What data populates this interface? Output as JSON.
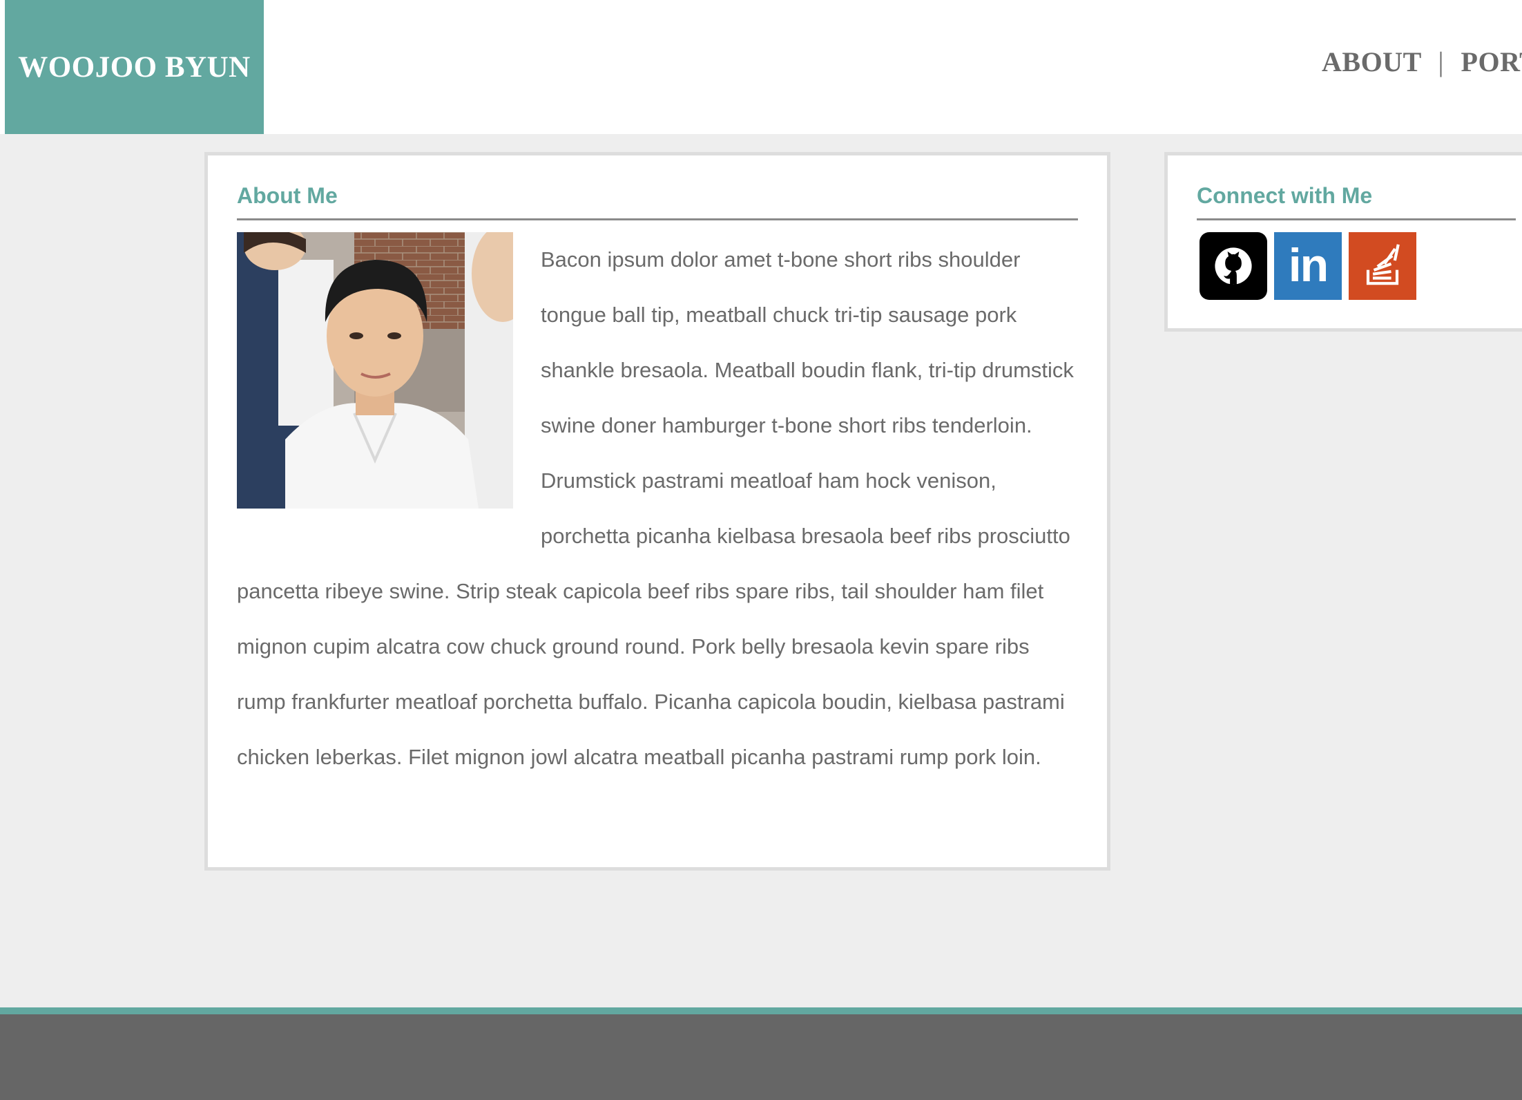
{
  "header": {
    "logo_text": "WOOJOO BYUN",
    "nav": {
      "about": "ABOUT",
      "separator": "|",
      "portfolio": "PORTI"
    }
  },
  "about": {
    "heading": "About Me",
    "photo_alt": "Portrait photo of a young man in a white shirt",
    "body": "Bacon ipsum dolor amet t-bone short ribs shoulder tongue ball tip, meatball chuck tri-tip sausage pork shankle bresaola. Meatball boudin flank, tri-tip drumstick swine doner hamburger t-bone short ribs tenderloin. Drumstick pastrami meatloaf ham hock venison, porchetta picanha kielbasa bresaola beef ribs prosciutto pancetta ribeye swine. Strip steak capicola beef ribs spare ribs, tail shoulder ham filet mignon cupim alcatra cow chuck ground round. Pork belly bresaola kevin spare ribs rump frankfurter meatloaf porchetta buffalo. Picanha capicola boudin, kielbasa pastrami chicken leberkas. Filet mignon jowl alcatra meatball picanha pastrami rump pork loin."
  },
  "connect": {
    "heading": "Connect with Me",
    "links": [
      {
        "name": "GitHub",
        "icon": "github-icon",
        "color": "#000000"
      },
      {
        "name": "LinkedIn",
        "icon": "linkedin-icon",
        "label": "in",
        "color": "#2f7bbd"
      },
      {
        "name": "Stack Overflow",
        "icon": "stackoverflow-icon",
        "color": "#d24b21"
      }
    ]
  },
  "colors": {
    "accent": "#62a8a0",
    "page_background": "#eeeeee",
    "text": "#6a6a6a",
    "footer": "#666666"
  }
}
